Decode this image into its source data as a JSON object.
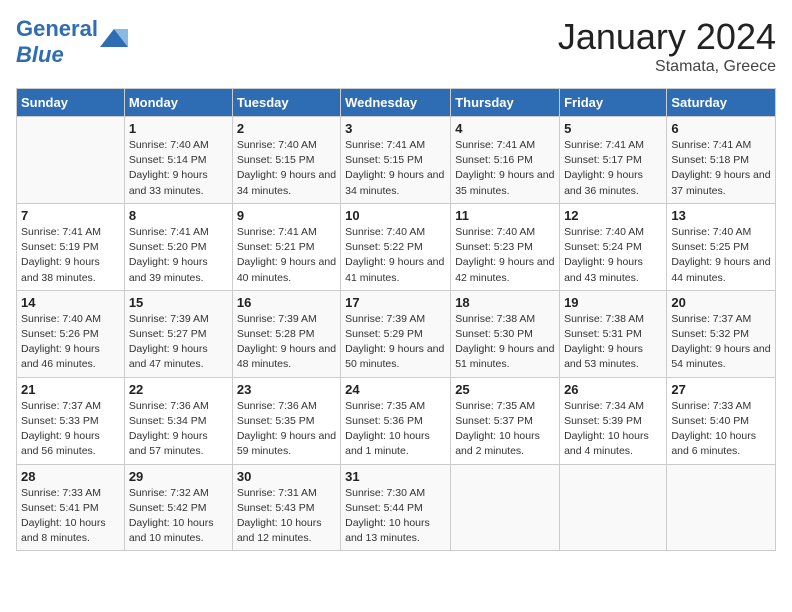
{
  "header": {
    "logo_general": "General",
    "logo_blue": "Blue",
    "month_title": "January 2024",
    "location": "Stamata, Greece"
  },
  "days_of_week": [
    "Sunday",
    "Monday",
    "Tuesday",
    "Wednesday",
    "Thursday",
    "Friday",
    "Saturday"
  ],
  "weeks": [
    [
      {
        "day": "",
        "sunrise": "",
        "sunset": "",
        "daylight": ""
      },
      {
        "day": "1",
        "sunrise": "Sunrise: 7:40 AM",
        "sunset": "Sunset: 5:14 PM",
        "daylight": "Daylight: 9 hours and 33 minutes."
      },
      {
        "day": "2",
        "sunrise": "Sunrise: 7:40 AM",
        "sunset": "Sunset: 5:15 PM",
        "daylight": "Daylight: 9 hours and 34 minutes."
      },
      {
        "day": "3",
        "sunrise": "Sunrise: 7:41 AM",
        "sunset": "Sunset: 5:15 PM",
        "daylight": "Daylight: 9 hours and 34 minutes."
      },
      {
        "day": "4",
        "sunrise": "Sunrise: 7:41 AM",
        "sunset": "Sunset: 5:16 PM",
        "daylight": "Daylight: 9 hours and 35 minutes."
      },
      {
        "day": "5",
        "sunrise": "Sunrise: 7:41 AM",
        "sunset": "Sunset: 5:17 PM",
        "daylight": "Daylight: 9 hours and 36 minutes."
      },
      {
        "day": "6",
        "sunrise": "Sunrise: 7:41 AM",
        "sunset": "Sunset: 5:18 PM",
        "daylight": "Daylight: 9 hours and 37 minutes."
      }
    ],
    [
      {
        "day": "7",
        "sunrise": "Sunrise: 7:41 AM",
        "sunset": "Sunset: 5:19 PM",
        "daylight": "Daylight: 9 hours and 38 minutes."
      },
      {
        "day": "8",
        "sunrise": "Sunrise: 7:41 AM",
        "sunset": "Sunset: 5:20 PM",
        "daylight": "Daylight: 9 hours and 39 minutes."
      },
      {
        "day": "9",
        "sunrise": "Sunrise: 7:41 AM",
        "sunset": "Sunset: 5:21 PM",
        "daylight": "Daylight: 9 hours and 40 minutes."
      },
      {
        "day": "10",
        "sunrise": "Sunrise: 7:40 AM",
        "sunset": "Sunset: 5:22 PM",
        "daylight": "Daylight: 9 hours and 41 minutes."
      },
      {
        "day": "11",
        "sunrise": "Sunrise: 7:40 AM",
        "sunset": "Sunset: 5:23 PM",
        "daylight": "Daylight: 9 hours and 42 minutes."
      },
      {
        "day": "12",
        "sunrise": "Sunrise: 7:40 AM",
        "sunset": "Sunset: 5:24 PM",
        "daylight": "Daylight: 9 hours and 43 minutes."
      },
      {
        "day": "13",
        "sunrise": "Sunrise: 7:40 AM",
        "sunset": "Sunset: 5:25 PM",
        "daylight": "Daylight: 9 hours and 44 minutes."
      }
    ],
    [
      {
        "day": "14",
        "sunrise": "Sunrise: 7:40 AM",
        "sunset": "Sunset: 5:26 PM",
        "daylight": "Daylight: 9 hours and 46 minutes."
      },
      {
        "day": "15",
        "sunrise": "Sunrise: 7:39 AM",
        "sunset": "Sunset: 5:27 PM",
        "daylight": "Daylight: 9 hours and 47 minutes."
      },
      {
        "day": "16",
        "sunrise": "Sunrise: 7:39 AM",
        "sunset": "Sunset: 5:28 PM",
        "daylight": "Daylight: 9 hours and 48 minutes."
      },
      {
        "day": "17",
        "sunrise": "Sunrise: 7:39 AM",
        "sunset": "Sunset: 5:29 PM",
        "daylight": "Daylight: 9 hours and 50 minutes."
      },
      {
        "day": "18",
        "sunrise": "Sunrise: 7:38 AM",
        "sunset": "Sunset: 5:30 PM",
        "daylight": "Daylight: 9 hours and 51 minutes."
      },
      {
        "day": "19",
        "sunrise": "Sunrise: 7:38 AM",
        "sunset": "Sunset: 5:31 PM",
        "daylight": "Daylight: 9 hours and 53 minutes."
      },
      {
        "day": "20",
        "sunrise": "Sunrise: 7:37 AM",
        "sunset": "Sunset: 5:32 PM",
        "daylight": "Daylight: 9 hours and 54 minutes."
      }
    ],
    [
      {
        "day": "21",
        "sunrise": "Sunrise: 7:37 AM",
        "sunset": "Sunset: 5:33 PM",
        "daylight": "Daylight: 9 hours and 56 minutes."
      },
      {
        "day": "22",
        "sunrise": "Sunrise: 7:36 AM",
        "sunset": "Sunset: 5:34 PM",
        "daylight": "Daylight: 9 hours and 57 minutes."
      },
      {
        "day": "23",
        "sunrise": "Sunrise: 7:36 AM",
        "sunset": "Sunset: 5:35 PM",
        "daylight": "Daylight: 9 hours and 59 minutes."
      },
      {
        "day": "24",
        "sunrise": "Sunrise: 7:35 AM",
        "sunset": "Sunset: 5:36 PM",
        "daylight": "Daylight: 10 hours and 1 minute."
      },
      {
        "day": "25",
        "sunrise": "Sunrise: 7:35 AM",
        "sunset": "Sunset: 5:37 PM",
        "daylight": "Daylight: 10 hours and 2 minutes."
      },
      {
        "day": "26",
        "sunrise": "Sunrise: 7:34 AM",
        "sunset": "Sunset: 5:39 PM",
        "daylight": "Daylight: 10 hours and 4 minutes."
      },
      {
        "day": "27",
        "sunrise": "Sunrise: 7:33 AM",
        "sunset": "Sunset: 5:40 PM",
        "daylight": "Daylight: 10 hours and 6 minutes."
      }
    ],
    [
      {
        "day": "28",
        "sunrise": "Sunrise: 7:33 AM",
        "sunset": "Sunset: 5:41 PM",
        "daylight": "Daylight: 10 hours and 8 minutes."
      },
      {
        "day": "29",
        "sunrise": "Sunrise: 7:32 AM",
        "sunset": "Sunset: 5:42 PM",
        "daylight": "Daylight: 10 hours and 10 minutes."
      },
      {
        "day": "30",
        "sunrise": "Sunrise: 7:31 AM",
        "sunset": "Sunset: 5:43 PM",
        "daylight": "Daylight: 10 hours and 12 minutes."
      },
      {
        "day": "31",
        "sunrise": "Sunrise: 7:30 AM",
        "sunset": "Sunset: 5:44 PM",
        "daylight": "Daylight: 10 hours and 13 minutes."
      },
      {
        "day": "",
        "sunrise": "",
        "sunset": "",
        "daylight": ""
      },
      {
        "day": "",
        "sunrise": "",
        "sunset": "",
        "daylight": ""
      },
      {
        "day": "",
        "sunrise": "",
        "sunset": "",
        "daylight": ""
      }
    ]
  ]
}
